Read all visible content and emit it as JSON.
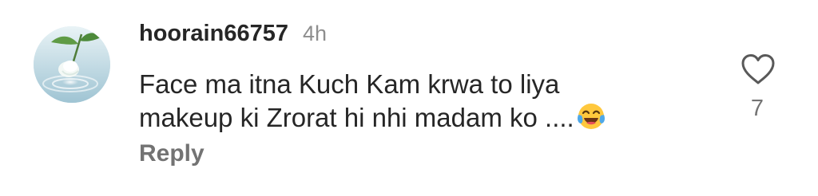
{
  "comment": {
    "username": "hoorain66757",
    "timestamp": "4h",
    "text": "Face ma itna Kuch Kam krwa to liya\nmakeup ki Zrorat hi nhi madam ko ....",
    "emoji": "face-with-tears-of-joy",
    "reply_label": "Reply",
    "like_icon": "heart-outline-icon",
    "like_count": "7"
  }
}
